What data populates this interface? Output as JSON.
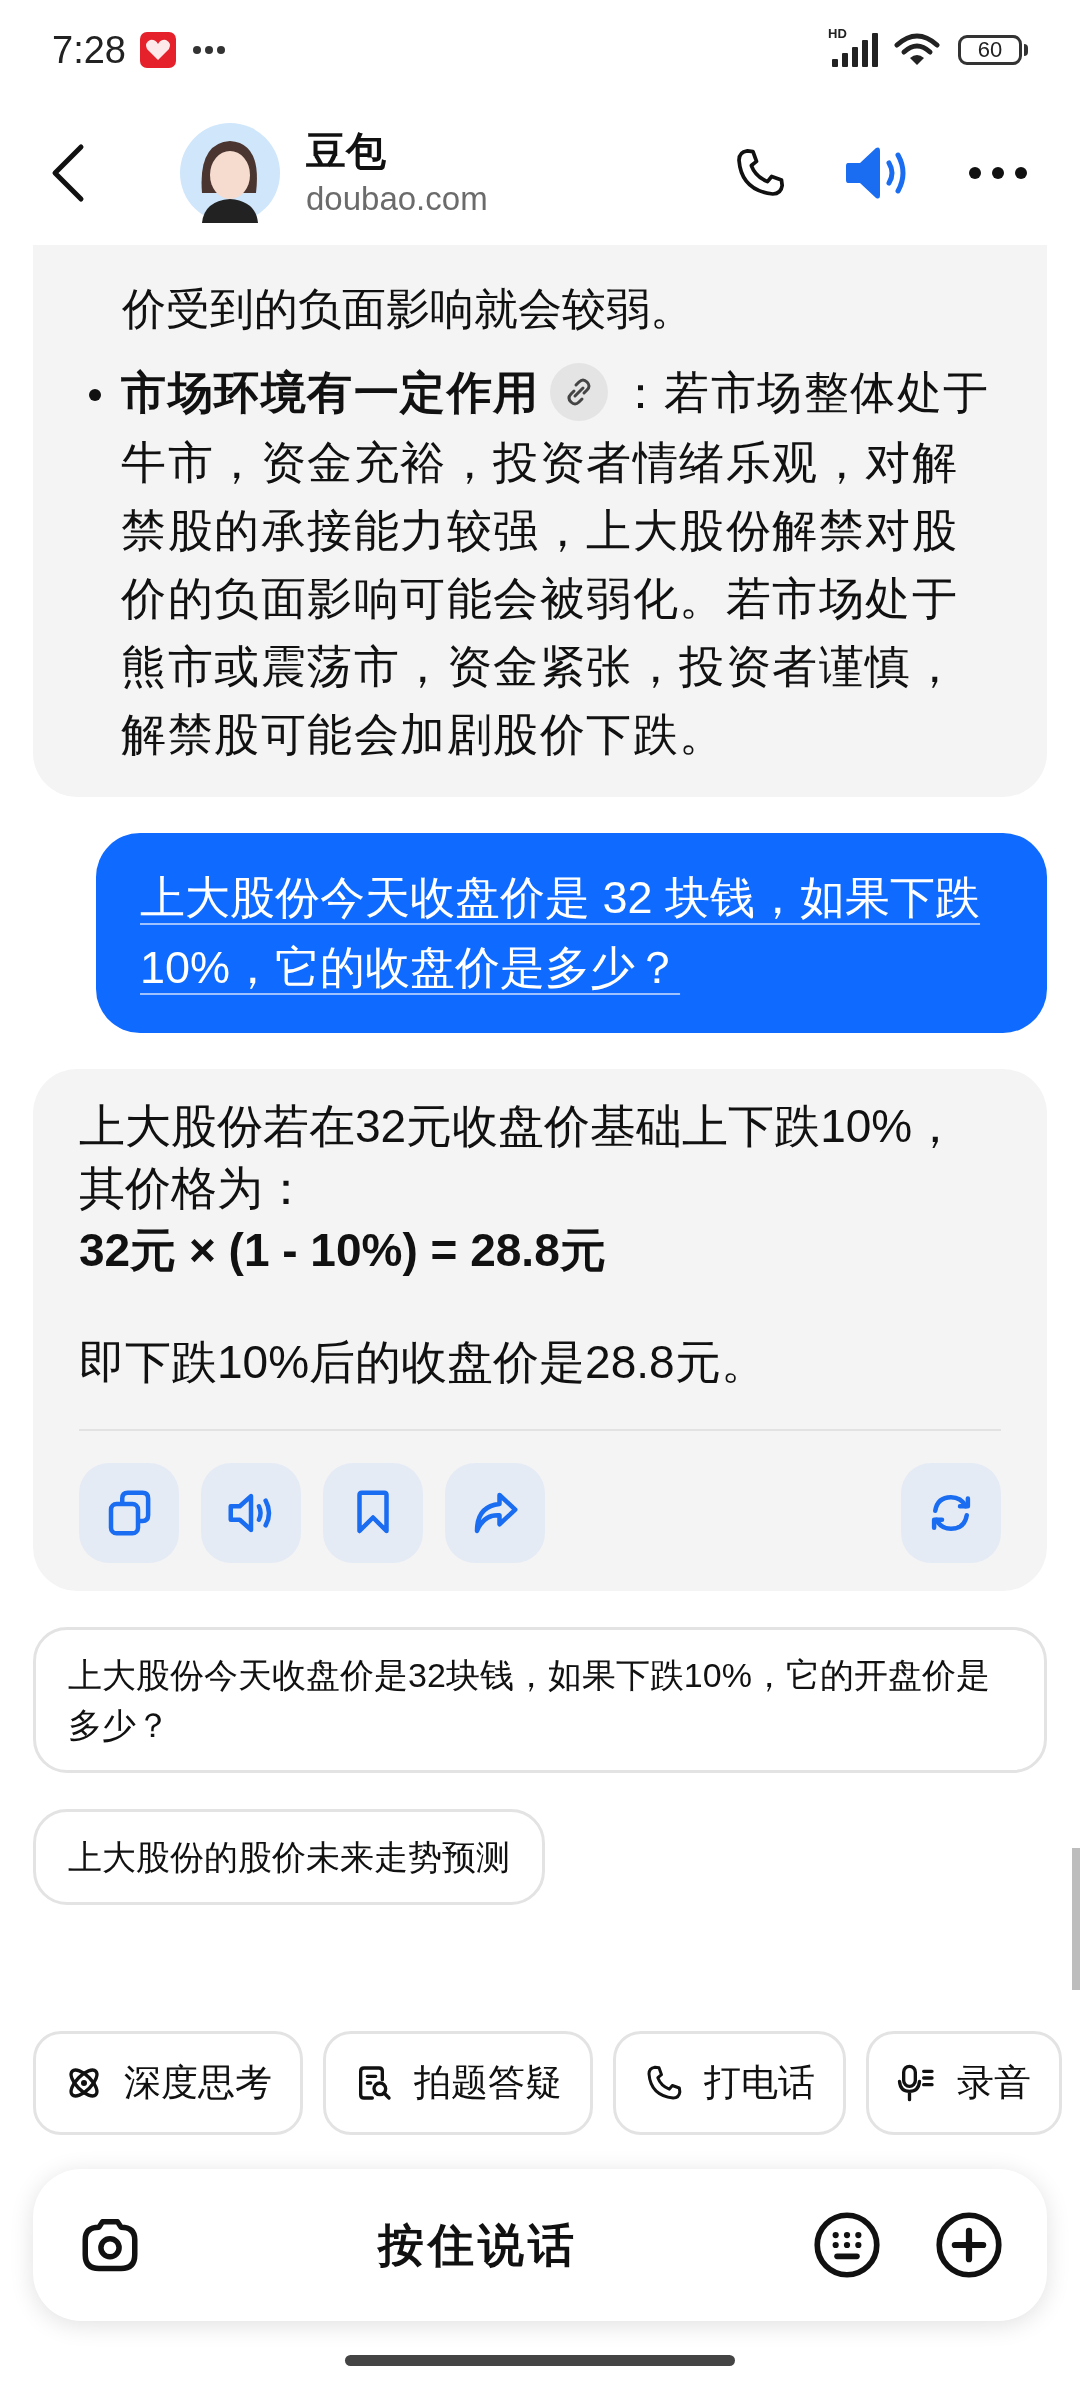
{
  "status_bar": {
    "time": "7:28",
    "network": "HD",
    "battery": "60"
  },
  "header": {
    "title": "豆包",
    "subtitle": "doubao.com"
  },
  "messages": [
    {
      "kind": "assistant",
      "blocks": [
        {
          "kind": "continuation",
          "text": "价受到的负面影响就会较弱。"
        },
        {
          "kind": "bullet",
          "title": "市场环境有一定作用",
          "source_link": true,
          "text": "：若市场整体处于牛市，资金充裕，投资者情绪乐观，对解禁股的承接能力较强，上大股份解禁对股价的负面影响可能会被弱化。若市场处于熊市或震荡市，资金紧张，投资者谨慎，解禁股可能会加剧股价下跌。"
        }
      ]
    },
    {
      "kind": "user",
      "text": "上大股份今天收盘价是 32 块钱，如果下跌 10%，它的收盘价是多少？"
    },
    {
      "kind": "assistant",
      "blocks": [
        {
          "kind": "line",
          "text": "上大股份若在32元收盘价基础上下跌10%，"
        },
        {
          "kind": "text",
          "text": "其价格为："
        },
        {
          "kind": "formula",
          "text": "32元 × (1 - 10%) = 28.8元"
        },
        {
          "kind": "text",
          "text": "即下跌10%后的收盘价是28.8元。"
        }
      ],
      "actions": [
        {
          "kind": "copy"
        },
        {
          "kind": "speak"
        },
        {
          "kind": "bookmark"
        },
        {
          "kind": "share"
        },
        {
          "kind": "regenerate"
        }
      ]
    }
  ],
  "suggestions": [
    "上大股份今天收盘价是32块钱，如果下跌10%，它的开盘价是多少？",
    "上大股份的股价未来走势预测"
  ],
  "shortcuts": [
    {
      "kind": "think",
      "label": "深度思考"
    },
    {
      "kind": "scan",
      "label": "拍题答疑"
    },
    {
      "kind": "call",
      "label": "打电话"
    },
    {
      "kind": "record",
      "label": "录音"
    }
  ],
  "input": {
    "label": "按住说话"
  }
}
